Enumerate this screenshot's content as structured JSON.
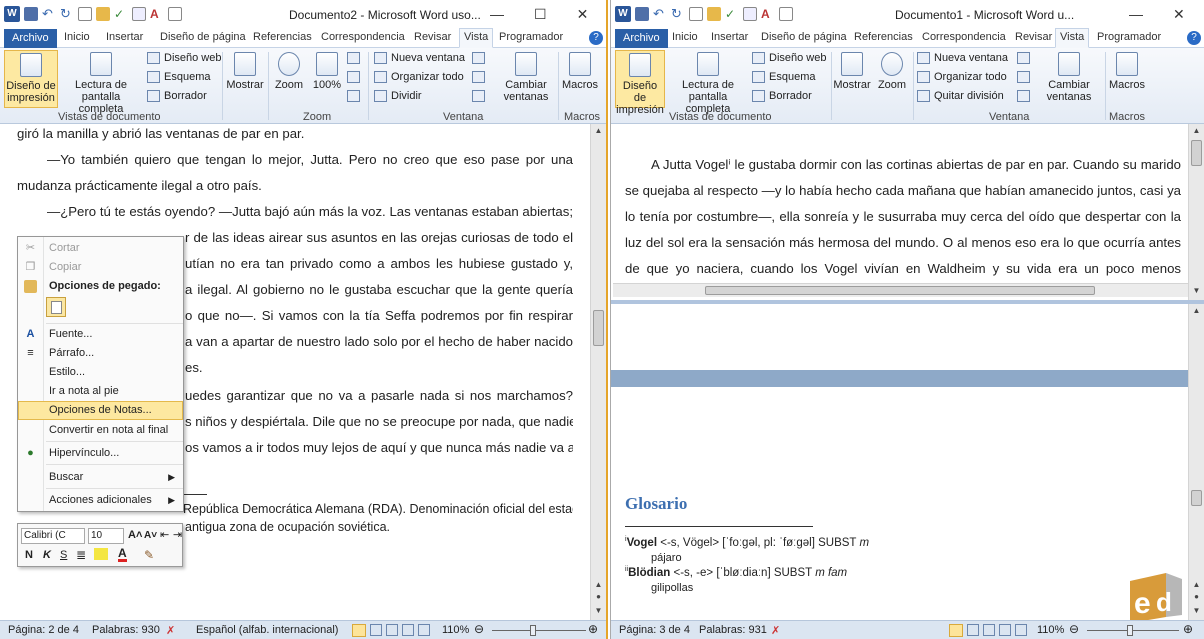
{
  "left": {
    "title": "Documento2 - Microsoft Word uso...",
    "tabs": [
      "Archivo",
      "Inicio",
      "Insertar",
      "Diseño de página",
      "Referencias",
      "Correspondencia",
      "Revisar",
      "Vista",
      "Programador"
    ],
    "ribbon": {
      "print_layout": "Diseño de impresión",
      "full_reading": "Lectura de pantalla completa",
      "web": "Diseño web",
      "outline": "Esquema",
      "draft": "Borrador",
      "show": "Mostrar",
      "zoom": "Zoom",
      "zoom100": "100%",
      "new_window": "Nueva ventana",
      "arrange": "Organizar todo",
      "split": "Dividir",
      "switch": "Cambiar ventanas",
      "macros": "Macros",
      "grp_views": "Vistas de documento",
      "grp_zoom": "Zoom",
      "grp_window": "Ventana",
      "grp_macros": "Macros"
    },
    "body": [
      "giró la manilla y abrió las ventanas de par en par.",
      "—Yo también quiero que tengan lo mejor, Jutta. Pero no creo que eso pase por una",
      "mudanza prácticamente ilegal a otro país.",
      "—¿Pero tú te estás oyendo? —Jutta bajó aún más la voz. Las ventanas estaban abiertas;",
      "r de las ideas airear sus asuntos en las orejas curiosas de todo el",
      "utían no era tan privado como a ambos les hubiese gustado y,",
      "a ilegal. Al gobierno no le gustaba escuchar que la gente quería",
      "o que no—. Si vamos con la tía Seffa podremos por fin respirar",
      "a van a apartar de nuestro lado solo por el hecho de haber nacido",
      "es.",
      "uedes garantizar que no va a pasarle nada si nos marchamos?",
      "s niños y despiértala. Dile que no se preocupe por nada, que nadie",
      "os vamos a ir todos muy lejos de aquí y que nunca más nadie va a"
    ],
    "footnote": "República Democrática Alemana (RDA). Denominación oficial del estado constituido en Alemania",
    "footnote2": "antigua zona de ocupación soviética.",
    "status": {
      "page": "Página: 2 de 4",
      "words": "Palabras: 930",
      "lang": "Español (alfab. internacional)",
      "zoom": "110%"
    }
  },
  "context_menu": {
    "items": [
      "Cortar",
      "Copiar",
      "Opciones de pegado:",
      "Fuente...",
      "Párrafo...",
      "Estilo...",
      "Ir a nota al pie",
      "Opciones de Notas...",
      "Convertir en nota al final",
      "Hipervínculo...",
      "Buscar",
      "Acciones adicionales"
    ]
  },
  "mini_toolbar": {
    "font": "Calibri (C",
    "size": "10"
  },
  "right": {
    "title": "Documento1 - Microsoft Word u...",
    "tabs": [
      "Archivo",
      "Inicio",
      "Insertar",
      "Diseño de página",
      "Referencias",
      "Correspondencia",
      "Revisar",
      "Vista",
      "Programador"
    ],
    "ribbon": {
      "print_layout": "Diseño de impresión",
      "full_reading": "Lectura de pantalla completa",
      "web": "Diseño web",
      "outline": "Esquema",
      "draft": "Borrador",
      "show": "Mostrar",
      "zoom": "Zoom",
      "new_window": "Nueva ventana",
      "arrange": "Organizar todo",
      "remove_split": "Quitar división",
      "switch": "Cambiar ventanas",
      "macros": "Macros",
      "grp_views": "Vistas de documento",
      "grp_window": "Ventana",
      "grp_macros": "Macros"
    },
    "body": [
      "A Jutta Vogelⁱ le gustaba dormir con las cortinas abiertas de par en par. Cuando su marido",
      "se quejaba al respecto —y lo había hecho cada mañana que habían amanecido juntos, casi ya",
      "lo tenía por costumbre—, ella sonreía y le susurraba muy cerca del oído que despertar con la",
      "luz del sol era la sensación más hermosa del mundo. O al menos eso era lo que ocurría antes",
      "de que yo naciera, cuando los Vogel vivían en Waldheim y su vida era un poco menos"
    ],
    "glossary_title": "Glosario",
    "gloss1": "Vogel",
    "gloss1_rest": " <-s, Vögel> [ˈfoːgəl, pl: ˈføːgəl] SUBST",
    "gloss1_m": "m",
    "gloss1_tr": "pájaro",
    "gloss2": "Blödian",
    "gloss2_rest": " <-s, -e> [ˈbløːdiaːn] SUBST",
    "gloss2_m": "m fam",
    "gloss2_tr": "gilipollas",
    "status": {
      "page": "Página: 3 de 4",
      "words": "Palabras: 931",
      "zoom": "110%"
    }
  }
}
